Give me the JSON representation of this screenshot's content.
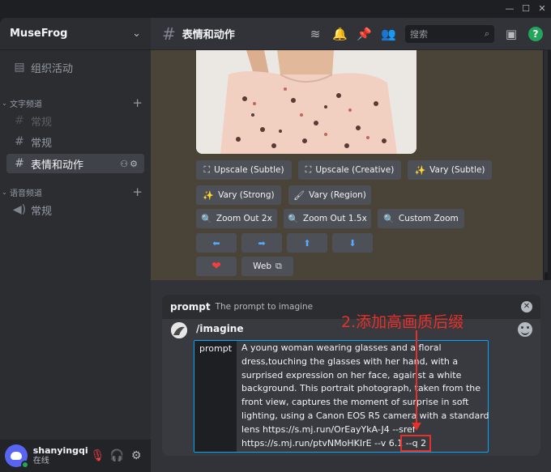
{
  "window": {
    "controls": [
      "—",
      "☐",
      "✕"
    ]
  },
  "sidebar": {
    "server_name": "MuseFrog",
    "items": [
      {
        "label": "组织活动",
        "icon": "calendar-icon"
      },
      {
        "category": "文字频道"
      },
      {
        "label": "常规",
        "icon": "hash-icon",
        "state": "muted"
      },
      {
        "label": "常规",
        "icon": "hash-icon"
      },
      {
        "label": "表情和动作",
        "icon": "hash-icon",
        "state": "active"
      },
      {
        "category": "语音频道"
      },
      {
        "label": "常规",
        "icon": "speaker-icon"
      }
    ],
    "event_label": "组织活动",
    "text_category": "文字频道",
    "text_channel_1": "常规",
    "text_channel_2": "常规",
    "active_channel": "表情和动作",
    "voice_category": "语音频道",
    "voice_channel": "常规"
  },
  "user": {
    "name": "shanyingqi",
    "status": "在线"
  },
  "header": {
    "channel": "表情和动作",
    "search_placeholder": "搜索"
  },
  "actions": {
    "upscale_subtle": "Upscale (Subtle)",
    "upscale_creative": "Upscale (Creative)",
    "vary_subtle": "Vary (Subtle)",
    "vary_strong": "Vary (Strong)",
    "vary_region": "Vary (Region)",
    "zoom_2x": "Zoom Out 2x",
    "zoom_15x": "Zoom Out 1.5x",
    "custom_zoom": "Custom Zoom",
    "pan_left": "⬅",
    "pan_right": "➡",
    "pan_up": "⬆",
    "pan_down": "⬇",
    "favorite": "❤",
    "web": "Web"
  },
  "command": {
    "name": "prompt",
    "description": "The prompt to imagine",
    "slash": "/imagine",
    "option_label": "prompt",
    "option_value": "A young woman wearing glasses and a floral\ndress,touching the glasses with her hand, with a\nsurprised expression on her face, against a white\nbackground. This portrait photograph, taken from the\nfront view, captures the moment of surprise in soft\nlighting, using a Canon EOS R5 camera with a standard\nlens https://s.mj.run/OrEayYkA-J4 --sref\nhttps://s.mj.run/ptvNMoHKIrE --v 6.1 --q 2"
  },
  "annotation": {
    "text": "2.添加高画质后缀",
    "color": "#e8302a"
  },
  "colors": {
    "accent": "#5865f2",
    "online": "#23a55a",
    "focus": "#00a8fc"
  }
}
